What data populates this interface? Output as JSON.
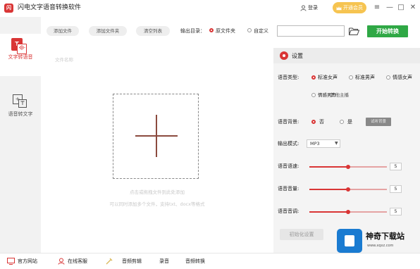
{
  "app": {
    "title": "闪电文字语音转换软件",
    "logo_glyph": "闪",
    "login_label": "登录",
    "vip_label": "开通会员",
    "window_controls": [
      "≡",
      "—",
      "□",
      "✕"
    ]
  },
  "sidebar": {
    "items": [
      {
        "label": "文字转语音",
        "icon": "text-to-speech-icon",
        "icon_glyph": "T",
        "active": true
      },
      {
        "label": "语音转文字",
        "icon": "speech-to-text-icon",
        "active": false
      }
    ]
  },
  "toolbar": {
    "add_file": "添加文件",
    "add_folder": "添加文件夹",
    "clear_list": "清空列表",
    "output_label": "输出目录：",
    "output_options": [
      {
        "label": "原文件夹",
        "selected": true
      },
      {
        "label": "自定义",
        "selected": false
      }
    ],
    "path_value": "",
    "start_label": "开始转换"
  },
  "main": {
    "list_header": "文件名称",
    "hint_line1": "点击或拖拽文件到此处添加",
    "hint_line2": "可以同时添加多个文件，支持txt、docx等格式"
  },
  "settings": {
    "title": "设置",
    "voice_type_label": "语音类型:",
    "voice_options": [
      {
        "label": "标准女声",
        "selected": true
      },
      {
        "label": "标准男声",
        "selected": false
      },
      {
        "label": "情感女声",
        "selected": false
      },
      {
        "label": "情感男声",
        "selected": false
      }
    ],
    "more_voices": "其他主播",
    "bg_label": "语音背景:",
    "bg_options": [
      {
        "label": "否",
        "selected": true
      },
      {
        "label": "是",
        "selected": false
      }
    ],
    "listen_label": "试听背景",
    "format_label": "输出模式:",
    "format_value": "MP3",
    "speed_label": "语音语速:",
    "speed_value": "5",
    "speed_level": 0.5,
    "volume_label": "语音音量:",
    "volume_value": "5",
    "volume_level": 0.5,
    "pitch_label": "语音音调:",
    "pitch_value": "5",
    "pitch_level": 0.5,
    "reset_label": "初始化设置"
  },
  "bottom": {
    "items": [
      {
        "label": "官方网站",
        "icon": "website-icon"
      },
      {
        "label": "在线客服",
        "icon": "customer-service-icon"
      },
      {
        "label": "音频剪辑",
        "icon": "audio-edit-icon"
      },
      {
        "label": "录音",
        "icon": "record-icon"
      },
      {
        "label": "音频转换",
        "icon": "audio-convert-icon"
      }
    ]
  },
  "watermark": {
    "text": "神奇下载站",
    "sub": "www.xqxz.com"
  },
  "colors": {
    "accent": "#d93535",
    "start_button": "#2fa845",
    "vip": "#f6c451",
    "watermark_blue": "#1a7bd1"
  }
}
